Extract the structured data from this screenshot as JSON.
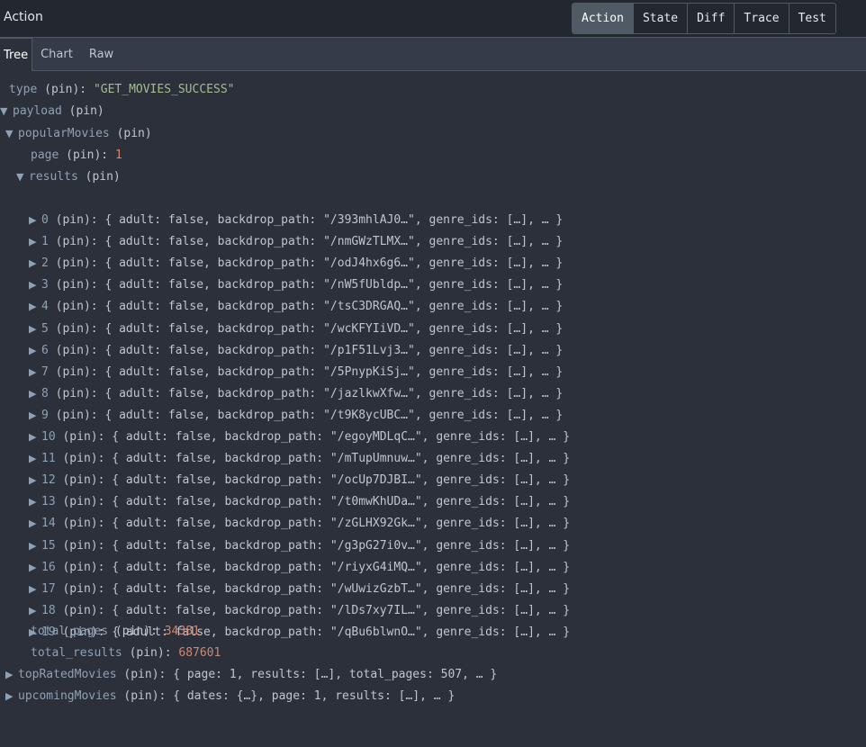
{
  "header": {
    "title": "Action",
    "buttons": [
      "Action",
      "State",
      "Diff",
      "Trace",
      "Test"
    ],
    "active_button": "Action"
  },
  "tabs": [
    "Tree",
    "Chart",
    "Raw"
  ],
  "active_tab": "Tree",
  "tree": {
    "type_key": "type",
    "type_value": "\"GET_MOVIES_SUCCESS\"",
    "payload_key": "payload",
    "pin_label": "(pin)",
    "popular_key": "popularMovies",
    "page_key": "page",
    "page_value": "1",
    "results_key": "results",
    "results": [
      {
        "index": "0",
        "path": "\"/393mhlAJ0…\""
      },
      {
        "index": "1",
        "path": "\"/nmGWzTLMX…\""
      },
      {
        "index": "2",
        "path": "\"/odJ4hx6g6…\""
      },
      {
        "index": "3",
        "path": "\"/nW5fUbldp…\""
      },
      {
        "index": "4",
        "path": "\"/tsC3DRGAQ…\""
      },
      {
        "index": "5",
        "path": "\"/wcKFYIiVD…\""
      },
      {
        "index": "6",
        "path": "\"/p1F51Lvj3…\""
      },
      {
        "index": "7",
        "path": "\"/5PnypKiSj…\""
      },
      {
        "index": "8",
        "path": "\"/jazlkwXfw…\""
      },
      {
        "index": "9",
        "path": "\"/t9K8ycUBC…\""
      },
      {
        "index": "10",
        "path": "\"/egoyMDLqC…\""
      },
      {
        "index": "11",
        "path": "\"/mTupUmnuw…\""
      },
      {
        "index": "12",
        "path": "\"/ocUp7DJBI…\""
      },
      {
        "index": "13",
        "path": "\"/t0mwKhUDa…\""
      },
      {
        "index": "14",
        "path": "\"/zGLHX92Gk…\""
      },
      {
        "index": "15",
        "path": "\"/g3pG27i0v…\""
      },
      {
        "index": "16",
        "path": "\"/riyxG4iMQ…\""
      },
      {
        "index": "17",
        "path": "\"/wUwizGzbT…\""
      },
      {
        "index": "18",
        "path": "\"/lDs7xy7IL…\""
      },
      {
        "index": "19",
        "path": "\"/qBu6blwnO…\""
      }
    ],
    "result_prefix": "{ adult: false, backdrop_path: ",
    "result_suffix": ", genre_ids: […], … }",
    "total_pages_key": "total_pages",
    "total_pages_value": "34381",
    "total_results_key": "total_results",
    "total_results_value": "687601",
    "top_rated_key": "topRatedMovies",
    "top_rated_preview": "{ page: 1, results: […], total_pages: 507, … }",
    "upcoming_key": "upcomingMovies",
    "upcoming_preview": "{ dates: {…}, page: 1, results: […], … }"
  }
}
